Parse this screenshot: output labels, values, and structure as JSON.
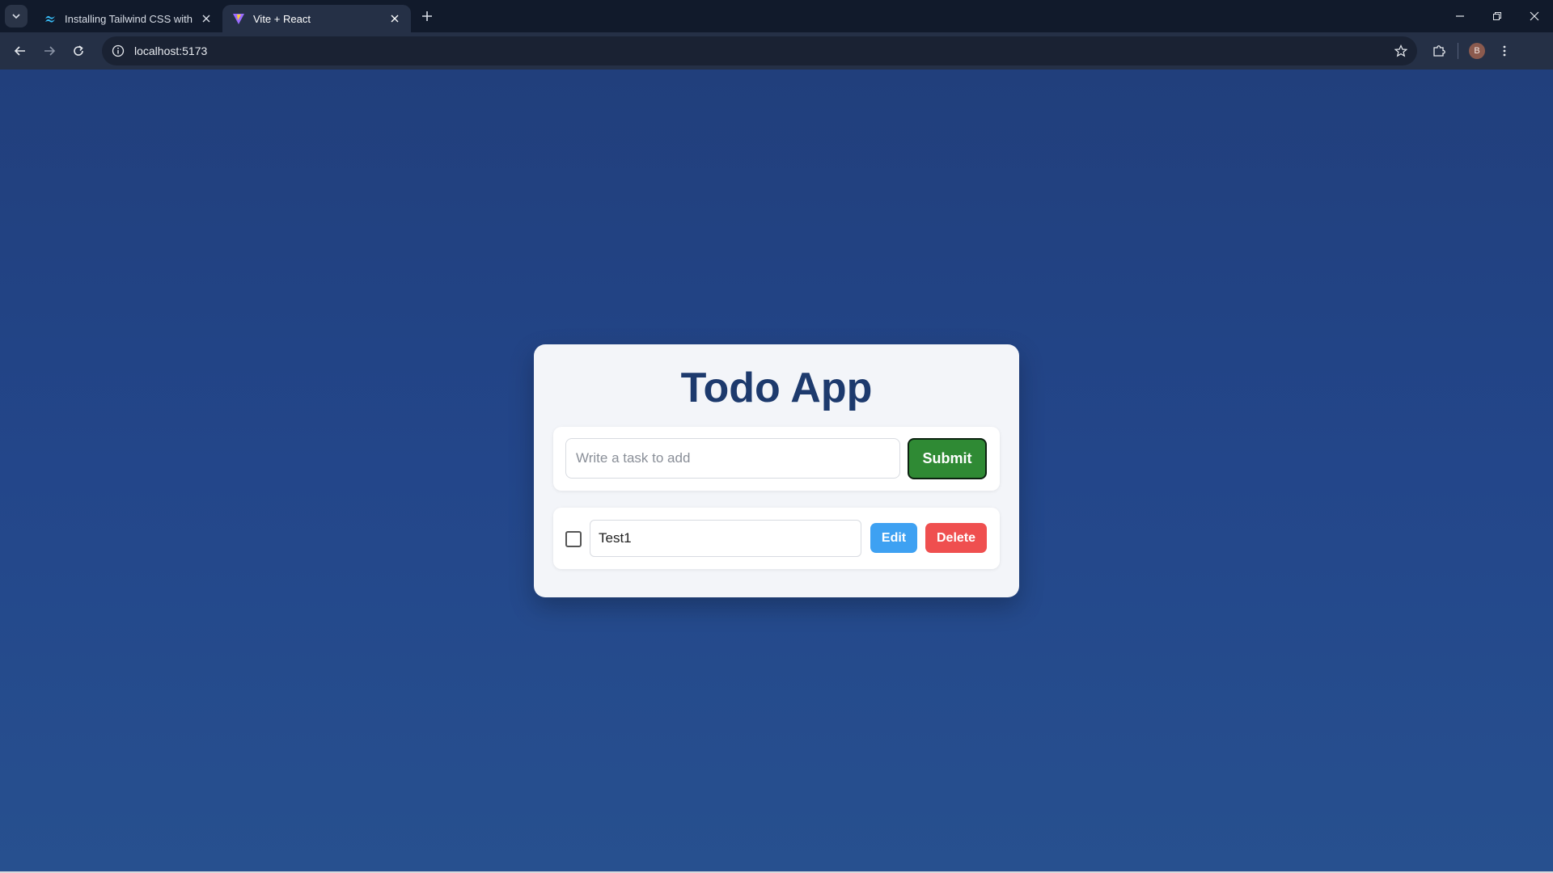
{
  "browser": {
    "tabs": [
      {
        "title": "Installing Tailwind CSS with Vite",
        "active": false
      },
      {
        "title": "Vite + React",
        "active": true
      }
    ],
    "address": "localhost:5173",
    "profile_initial": "B"
  },
  "app": {
    "title": "Todo App",
    "input_placeholder": "Write a task to add",
    "input_value": "",
    "submit_label": "Submit",
    "todos": [
      {
        "text": "Test1",
        "completed": false,
        "edit_label": "Edit",
        "delete_label": "Delete"
      }
    ]
  },
  "colors": {
    "background": "#23468a",
    "title": "#1d3a6d",
    "submit": "#2f8a34",
    "edit": "#3ea1f2",
    "delete": "#ef4f4f"
  }
}
